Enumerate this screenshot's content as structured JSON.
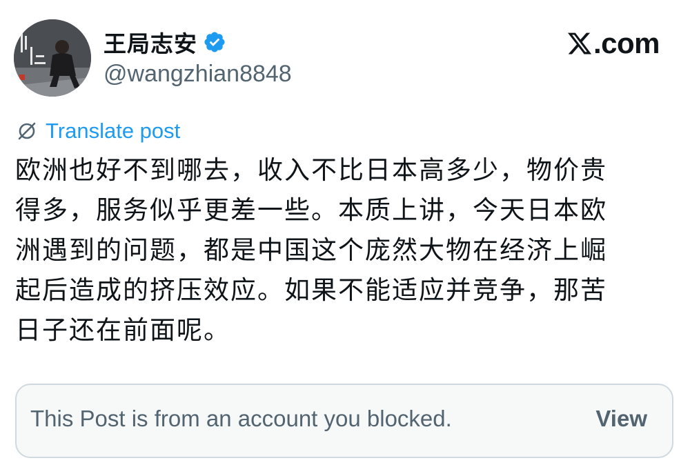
{
  "author": {
    "display_name": "王局志安",
    "handle": "@wangzhian8848",
    "verified": true,
    "avatar_icon": "profile-photo"
  },
  "brand": {
    "logo_text": ".com",
    "logo_icon": "x-logo-icon"
  },
  "translate": {
    "label": "Translate post",
    "icon": "translate-globe-icon",
    "color": "#1d9bf0"
  },
  "post": {
    "lines": [
      "欧洲也好不到哪去，收入不比日本高多少，物价贵",
      "得多，服务似乎更差一些。本质上讲，今天日本欧",
      "洲遇到的问题，都是中国这个庞然大物在经济上崛",
      "起后造成的挤压效应。如果不能适应并竞争，那苦",
      "日子还在前面呢。"
    ]
  },
  "blocked_quote": {
    "message": "This Post is from an account you blocked.",
    "action_label": "View"
  },
  "colors": {
    "text_primary": "#0f1419",
    "text_secondary": "#536471",
    "verified_badge": "#1d9bf0",
    "card_border": "#cfd9de",
    "card_background": "#f7f9f9"
  }
}
